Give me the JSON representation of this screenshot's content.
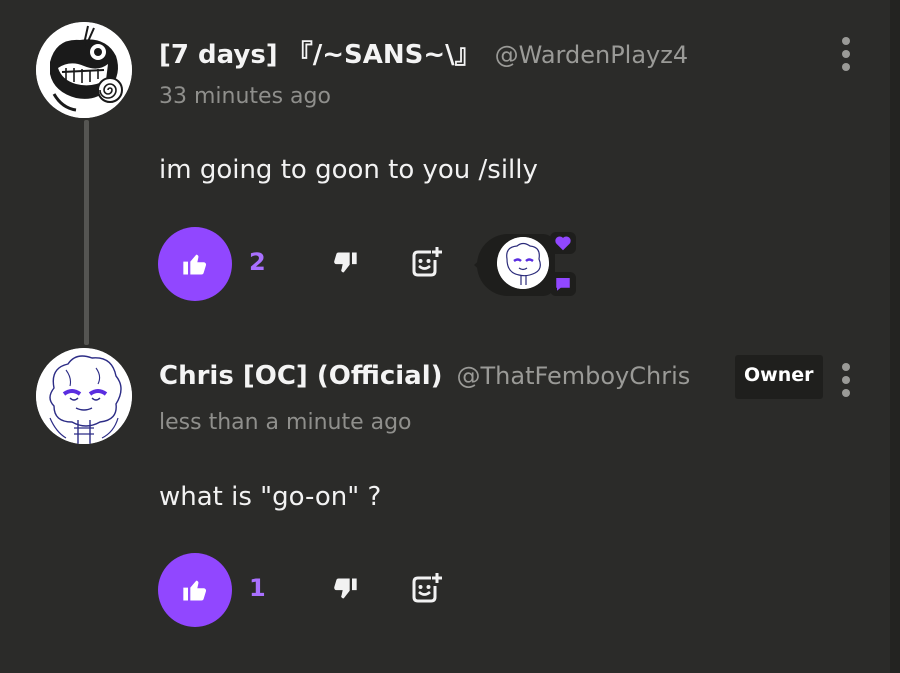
{
  "colors": {
    "background": "#2b2b29",
    "accent": "#9147ff",
    "accent_text": "#a970ff",
    "muted_text": "#9a9a97",
    "badge_bg": "#1f1f1d"
  },
  "comments": [
    {
      "author": "[7 days] 『/~SANS~\\』",
      "handle": "@WardenPlayz4",
      "time": "33 minutes ago",
      "text": "im going to goon to you /silly",
      "likes": "2",
      "avatar_icon": "cartoon-skull-avatar",
      "reactions": [
        "heart-icon",
        "comment-bubble-icon"
      ]
    },
    {
      "author": "Chris [OC] (Official)",
      "handle": "@ThatFemboyChris",
      "badge": "Owner",
      "time": "less than a minute ago",
      "text": "what is \"go-on\" ?",
      "likes": "1",
      "avatar_icon": "sketch-character-avatar"
    }
  ],
  "icons": {
    "like": "thumbs-up-icon",
    "dislike": "thumbs-down-icon",
    "react": "add-reaction-icon",
    "more": "more-options-icon"
  }
}
